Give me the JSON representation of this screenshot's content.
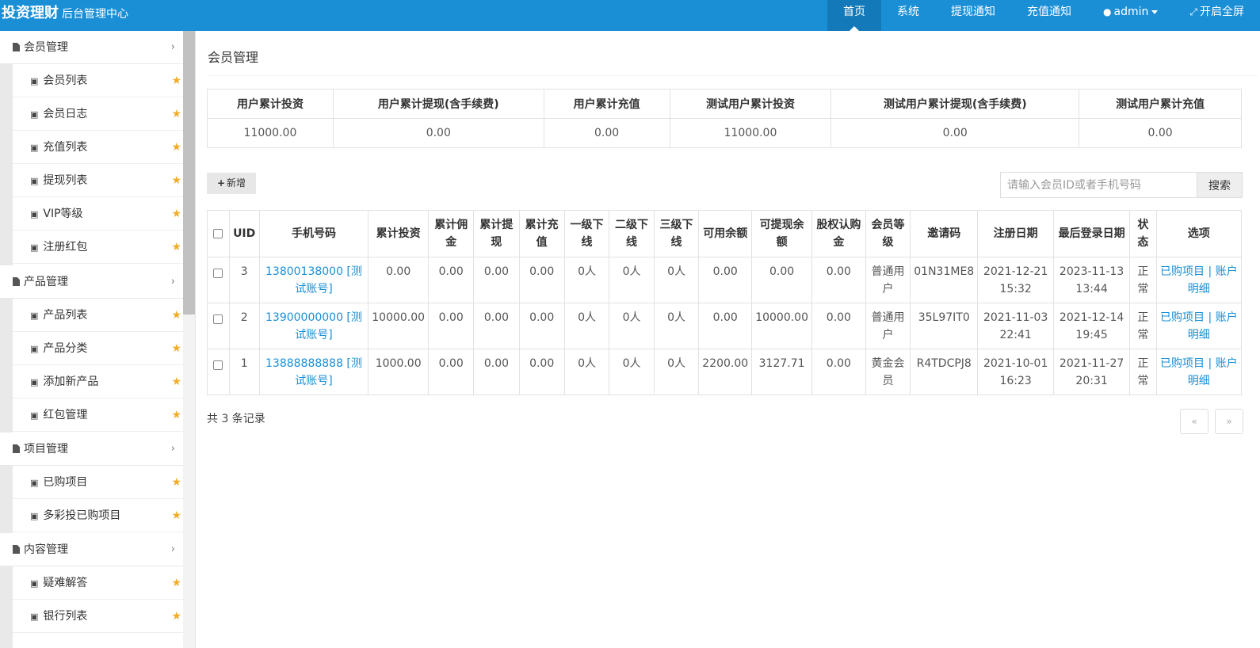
{
  "header": {
    "brand": "投资理财",
    "subtitle": "后台管理中心",
    "nav": [
      "首页",
      "系统",
      "提现通知",
      "充值通知"
    ],
    "user": "admin",
    "fullscreen": "开启全屏"
  },
  "sidebar": {
    "groups": [
      {
        "title": "会员管理",
        "items": [
          "会员列表",
          "会员日志",
          "充值列表",
          "提现列表",
          "VIP等级",
          "注册红包"
        ]
      },
      {
        "title": "产品管理",
        "items": [
          "产品列表",
          "产品分类",
          "添加新产品",
          "红包管理"
        ]
      },
      {
        "title": "项目管理",
        "items": [
          "已购项目",
          "多彩投已购项目"
        ]
      },
      {
        "title": "内容管理",
        "items": [
          "疑难解答",
          "银行列表"
        ]
      }
    ]
  },
  "main": {
    "title": "会员管理",
    "stats": {
      "headers": [
        "用户累计投资",
        "用户累计提现(含手续费)",
        "用户累计充值",
        "测试用户累计投资",
        "测试用户累计提现(含手续费)",
        "测试用户累计充值"
      ],
      "values": [
        "11000.00",
        "0.00",
        "0.00",
        "11000.00",
        "0.00",
        "0.00"
      ]
    },
    "add_label": "新增",
    "search_placeholder": "请输入会员ID或者手机号码",
    "search_label": "搜索",
    "table": {
      "headers": [
        "UID",
        "手机号码",
        "累计投资",
        "累计佣金",
        "累计提现",
        "累计充值",
        "一级下线",
        "二级下线",
        "三级下线",
        "可用余额",
        "可提现余额",
        "股权认购金",
        "会员等级",
        "邀请码",
        "注册日期",
        "最后登录日期",
        "状态",
        "选项"
      ],
      "rows": [
        {
          "uid": "3",
          "phone": "13800138000 [测试账号]",
          "invest": "0.00",
          "commission": "0.00",
          "withdraw": "0.00",
          "recharge": "0.00",
          "l1": "0人",
          "l2": "0人",
          "l3": "0人",
          "balance": "0.00",
          "withdrawable": "0.00",
          "equity": "0.00",
          "level": "普通用户",
          "invite": "01N31ME8",
          "reg_date": "2021-12-21 15:32",
          "last_login": "2023-11-13 13:44",
          "status": "正常",
          "opt1": "已购项目",
          "sep": "|",
          "opt2": "账户明细"
        },
        {
          "uid": "2",
          "phone": "13900000000 [测试账号]",
          "invest": "10000.00",
          "commission": "0.00",
          "withdraw": "0.00",
          "recharge": "0.00",
          "l1": "0人",
          "l2": "0人",
          "l3": "0人",
          "balance": "0.00",
          "withdrawable": "10000.00",
          "equity": "0.00",
          "level": "普通用户",
          "invite": "35L97IT0",
          "reg_date": "2021-11-03 22:41",
          "last_login": "2021-12-14 19:45",
          "status": "正常",
          "opt1": "已购项目",
          "sep": "|",
          "opt2": "账户明细"
        },
        {
          "uid": "1",
          "phone": "13888888888 [测试账号]",
          "invest": "1000.00",
          "commission": "0.00",
          "withdraw": "0.00",
          "recharge": "0.00",
          "l1": "0人",
          "l2": "0人",
          "l3": "0人",
          "balance": "2200.00",
          "withdrawable": "3127.71",
          "equity": "0.00",
          "level": "黄金会员",
          "invite": "R4TDCPJ8",
          "reg_date": "2021-10-01 16:23",
          "last_login": "2021-11-27 20:31",
          "status": "正常",
          "opt1": "已购项目",
          "sep": "|",
          "opt2": "账户明细"
        }
      ]
    },
    "total": "共 3 条记录",
    "pager": {
      "prev": "«",
      "next": "»"
    }
  }
}
